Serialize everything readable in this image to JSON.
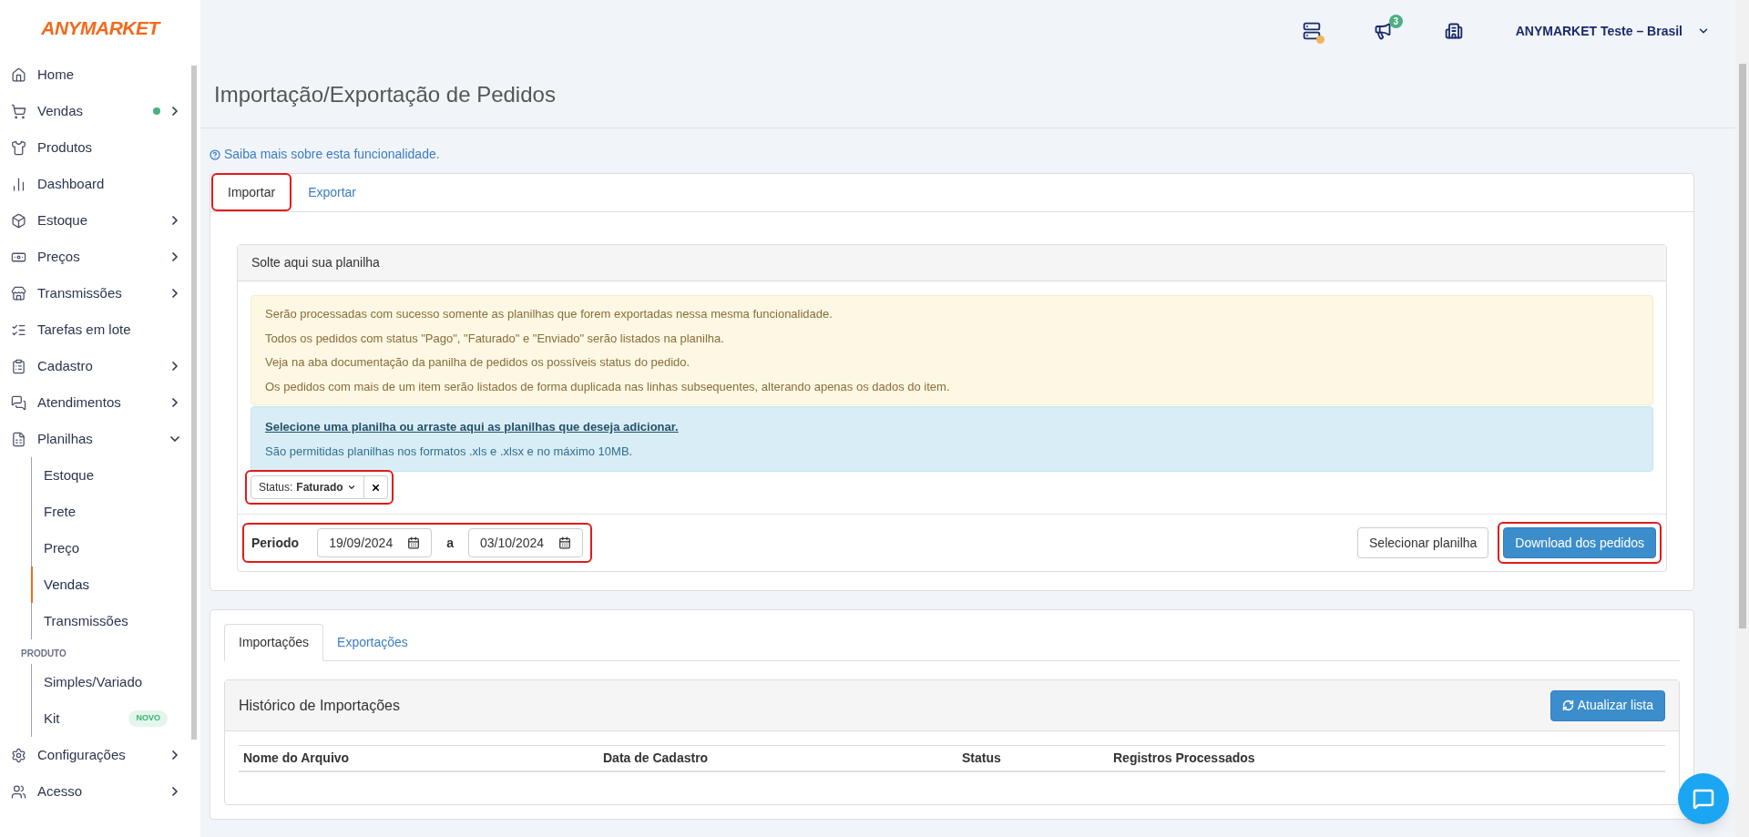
{
  "brand": "ANYMARKET",
  "topbar": {
    "notification_count": "3",
    "account": "ANYMARKET Teste – Brasil"
  },
  "sidebar": {
    "items": [
      {
        "kind": "link",
        "label": "Home"
      },
      {
        "kind": "group",
        "label": "Vendas",
        "expanded": false,
        "color": "#4caf82"
      },
      {
        "kind": "link",
        "label": "Produtos"
      },
      {
        "kind": "link",
        "label": "Dashboard"
      },
      {
        "kind": "group",
        "label": "Estoque",
        "expanded": false
      },
      {
        "kind": "group",
        "label": "Preços",
        "expanded": false
      },
      {
        "kind": "group",
        "label": "Transmissões",
        "expanded": false
      },
      {
        "kind": "link",
        "label": "Tarefas em lote"
      },
      {
        "kind": "group",
        "label": "Cadastro",
        "expanded": false
      },
      {
        "kind": "group",
        "label": "Atendimentos",
        "expanded": false
      },
      {
        "kind": "group",
        "label": "Planilhas",
        "expanded": true,
        "children": [
          {
            "label": "Estoque",
            "selected": false
          },
          {
            "label": "Frete",
            "selected": false
          },
          {
            "label": "Preço",
            "selected": false
          },
          {
            "label": "Vendas",
            "selected": true
          },
          {
            "label": "Transmissões",
            "selected": false
          }
        ]
      },
      {
        "kind": "section",
        "label": "PRODUTO",
        "children": [
          {
            "label": "Simples/Variado",
            "selected": false
          },
          {
            "label": "Kit",
            "selected": false,
            "badge": "NOVO"
          }
        ]
      },
      {
        "kind": "group",
        "label": "Configurações",
        "expanded": false
      },
      {
        "kind": "group",
        "label": "Acesso",
        "expanded": false
      }
    ]
  },
  "page_title": "Importação/Exportação de Pedidos",
  "help_link": "Saiba mais sobre esta funcionalidade.",
  "tabs": [
    {
      "label": "Importar",
      "selected": true,
      "highlighted": true
    },
    {
      "label": "Exportar",
      "selected": false,
      "highlighted": false
    }
  ],
  "upload_panel": {
    "title": "Solte aqui sua planilha",
    "warnings": [
      "Serão processadas com sucesso somente as planilhas que forem exportadas nessa mesma funcionalidade.",
      "Todos os pedidos com status \"Pago\", \"Faturado\" e \"Enviado\" serão listados na planilha.",
      "Veja na aba documentação da panilha de pedidos os possíveis status do pedido.",
      "Os pedidos com mais de um item serão listados de forma duplicada nas linhas subsequentes, alterando apenas os dados do item."
    ],
    "dropzone": {
      "link": "Selecione uma planilha ou arraste aqui as planilhas que deseja adicionar.",
      "note": "São permitidas planilhas nos formatos .xls e .xlsx e no máximo 10MB."
    },
    "filter": {
      "label": "Status:",
      "value": "Faturado",
      "highlighted": true
    },
    "period": {
      "label": "Periodo",
      "from": "19/09/2024",
      "separator": "a",
      "to": "03/10/2024",
      "highlighted": true
    },
    "buttons": [
      {
        "label": "Selecionar planilha",
        "kind": "default",
        "highlighted": false
      },
      {
        "label": "Download dos pedidos",
        "kind": "primary",
        "highlighted": true
      }
    ]
  },
  "history": {
    "tabs": [
      {
        "label": "Importações",
        "selected": true
      },
      {
        "label": "Exportações",
        "selected": false
      }
    ],
    "title": "Histórico de Importações",
    "refresh_button": "Atualizar lista",
    "columns": [
      "Nome do Arquivo",
      "Data de Cadastro",
      "Status",
      "Registros Processados"
    ]
  }
}
